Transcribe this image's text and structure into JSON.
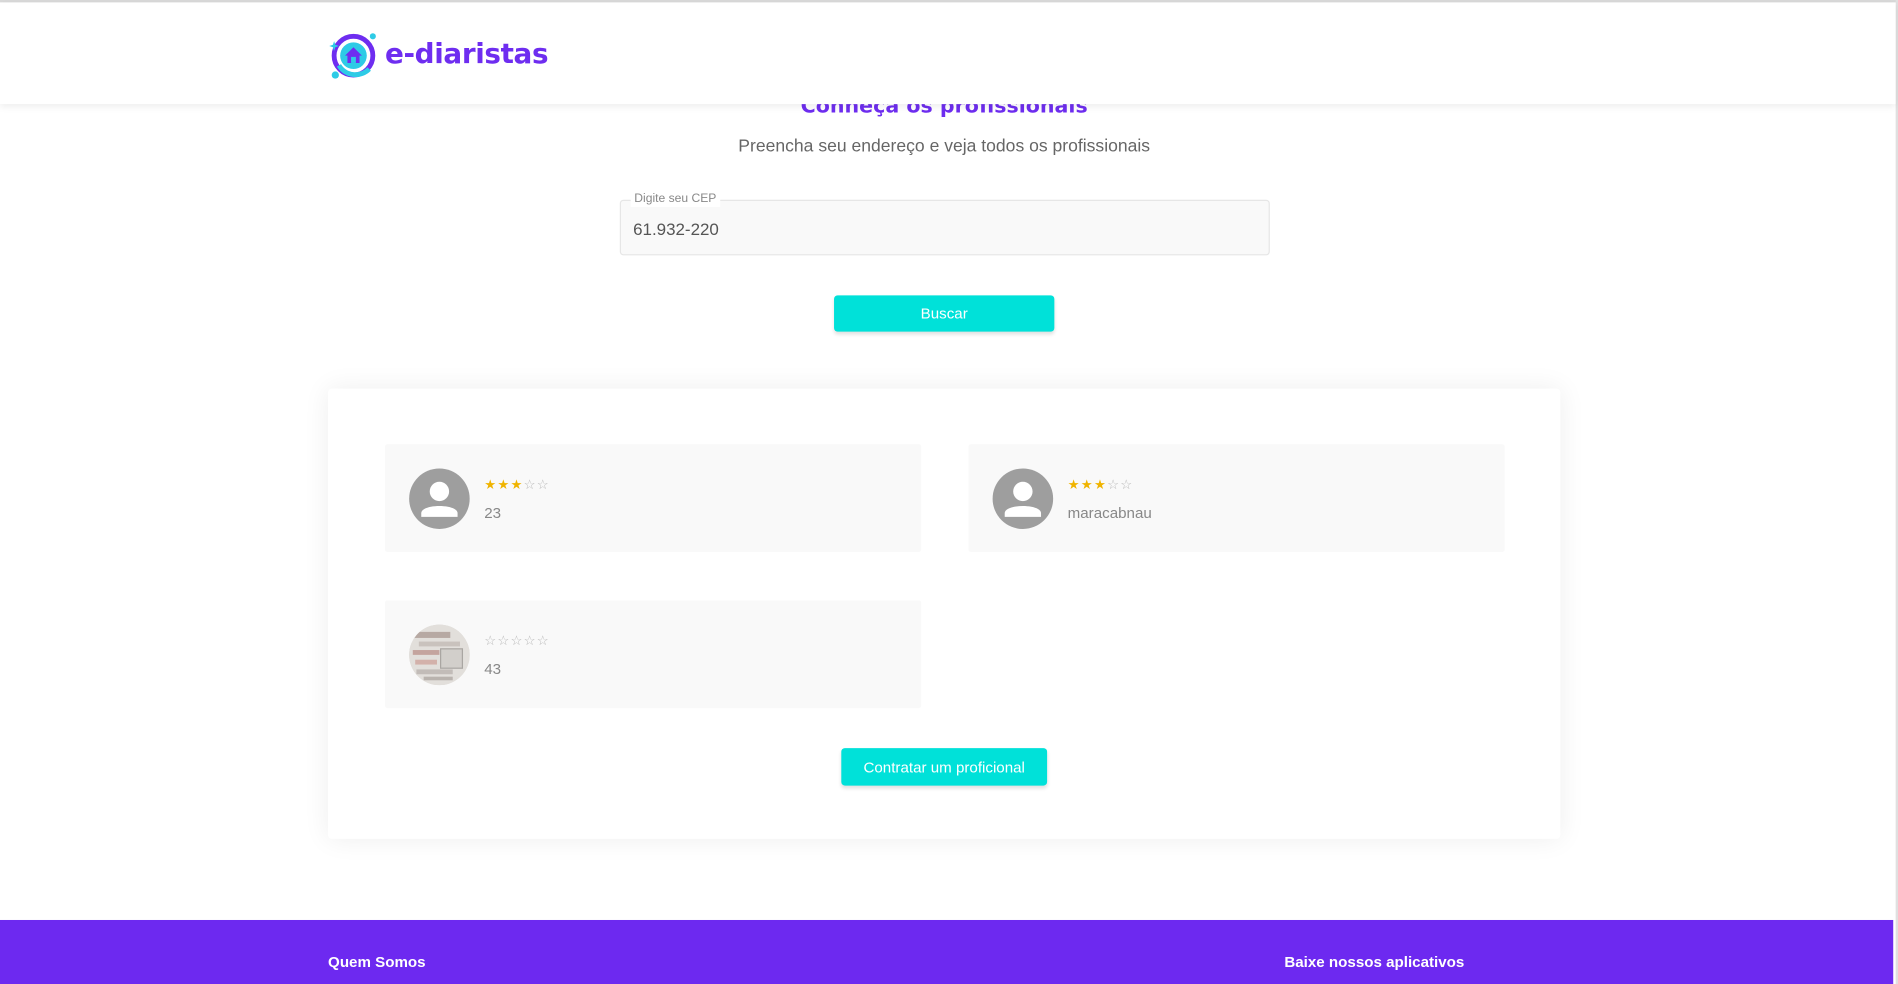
{
  "brand": {
    "name": "e-diaristas",
    "accent": "#6e2df0",
    "button_color": "#00e1d9",
    "footer_color": "#6d29f0",
    "star_color": "#f0b400"
  },
  "search": {
    "title": "Conheça os profissionais",
    "subtitle": "Preencha seu endereço e veja todos os profissionais",
    "cep_label": "Digite seu CEP",
    "cep_value": "61.932-220",
    "button_label": "Buscar"
  },
  "professionals": [
    {
      "name": "23",
      "rating": 3,
      "max_rating": 5,
      "avatar": "default-user-icon"
    },
    {
      "name": "maracabnau",
      "rating": 3,
      "max_rating": 5,
      "avatar": "default-user-icon"
    },
    {
      "name": "43",
      "rating": 0,
      "max_rating": 5,
      "avatar": "photo"
    }
  ],
  "hire_button_label": "Contratar um proficional",
  "footer": {
    "about_heading": "Quem Somos",
    "apps_heading": "Baixe nossos aplicativos"
  }
}
